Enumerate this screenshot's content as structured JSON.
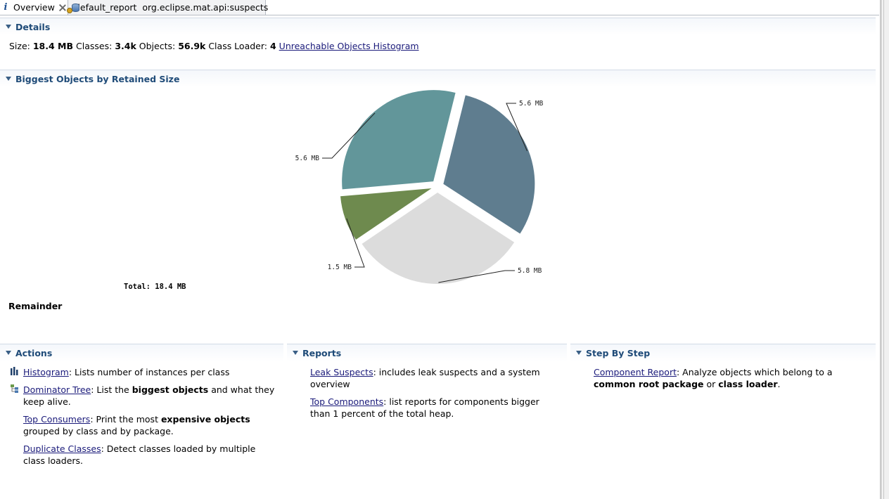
{
  "tabs": [
    {
      "label": "Overview",
      "icon": "info-icon",
      "closable": true
    },
    {
      "label": "default_report  org.eclipse.mat.api:suspects",
      "icon": "heap-dump-icon"
    }
  ],
  "details": {
    "title": "Details",
    "size_label": "Size:",
    "size_value": "18.4 MB",
    "classes_label": "Classes:",
    "classes_value": "3.4k",
    "objects_label": "Objects:",
    "objects_value": "56.9k",
    "loader_label": "Class Loader:",
    "loader_value": "4",
    "link": "Unreachable Objects Histogram"
  },
  "biggest": {
    "title": "Biggest Objects by Retained Size",
    "total": "Total: 18.4 MB",
    "remainder": "Remainder"
  },
  "chart_data": {
    "type": "pie",
    "slices": [
      {
        "label": "5.6 MB",
        "value": 5.6,
        "color": "#5f7d8f"
      },
      {
        "label": "5.8 MB",
        "value": 5.8,
        "color": "#dcdcdc"
      },
      {
        "label": "1.5 MB",
        "value": 1.5,
        "color": "#6e8a4e"
      },
      {
        "label": "5.6 MB",
        "value": 5.6,
        "color": "#62969a"
      }
    ],
    "total_label": "Total: 18.4 MB"
  },
  "actions": {
    "title": "Actions",
    "items": [
      {
        "link": "Histogram",
        "pre": ": Lists number of instances per class",
        "b1": "",
        "mid": "",
        "b2": "",
        "post": "",
        "icon": "histogram-icon"
      },
      {
        "link": "Dominator Tree",
        "pre": ": List the ",
        "b1": "biggest objects",
        "mid": " and what they keep alive.",
        "b2": "",
        "post": "",
        "icon": "dominator-tree-icon"
      },
      {
        "link": "Top Consumers",
        "pre": ": Print the most ",
        "b1": "expensive objects",
        "mid": " grouped by class and by package.",
        "b2": "",
        "post": ""
      },
      {
        "link": "Duplicate Classes",
        "pre": ": Detect classes loaded by multiple class loaders.",
        "b1": "",
        "mid": "",
        "b2": "",
        "post": ""
      }
    ]
  },
  "reports": {
    "title": "Reports",
    "items": [
      {
        "link": "Leak Suspects",
        "pre": ": includes leak suspects and a system overview"
      },
      {
        "link": "Top Components",
        "pre": ": list reports for components bigger than 1 percent of the total heap."
      }
    ]
  },
  "stepbystep": {
    "title": "Step By Step",
    "items": [
      {
        "link": "Component Report",
        "pre": ": Analyze objects which belong to a ",
        "b1": "common root package",
        "mid": " or ",
        "b2": "class loader",
        "post": "."
      }
    ]
  }
}
